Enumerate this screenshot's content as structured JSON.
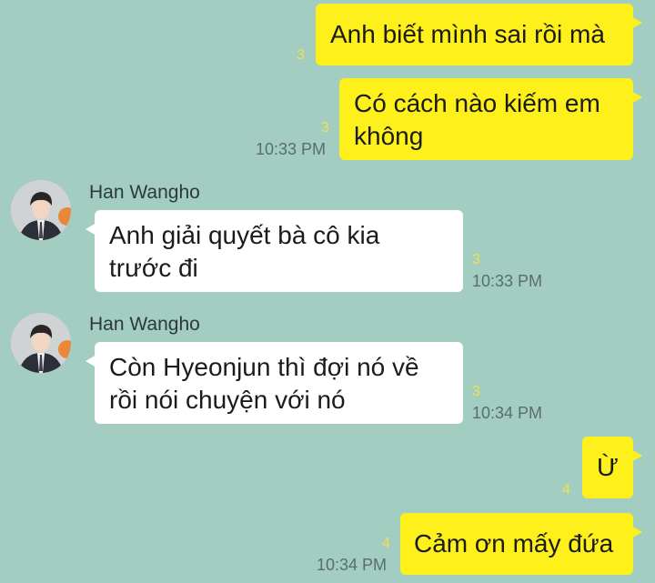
{
  "messages": [
    {
      "id": "m1",
      "side": "mine",
      "text": "Anh biết mình sai rồi mà",
      "unread": "3",
      "time": ""
    },
    {
      "id": "m2",
      "side": "mine",
      "text": "Có cách nào kiếm em không",
      "unread": "3",
      "time": "10:33 PM"
    },
    {
      "id": "m3",
      "side": "theirs",
      "sender": "Han Wangho",
      "text": "Anh giải quyết bà cô kia trước đi",
      "unread": "3",
      "time": "10:33 PM"
    },
    {
      "id": "m4",
      "side": "theirs",
      "sender": "Han Wangho",
      "text": "Còn Hyeonjun thì đợi nó về rồi nói chuyện với nó",
      "unread": "3",
      "time": "10:34 PM"
    },
    {
      "id": "m5",
      "side": "mine",
      "text": "Ừ",
      "unread": "4",
      "time": ""
    },
    {
      "id": "m6",
      "side": "mine",
      "text": "Cảm ơn mấy đứa",
      "unread": "4",
      "time": "10:34 PM"
    }
  ],
  "colors": {
    "background": "#a3cdc1",
    "my_bubble": "#fef01b",
    "their_bubble": "#ffffff",
    "unread_count": "#f2e14a"
  }
}
